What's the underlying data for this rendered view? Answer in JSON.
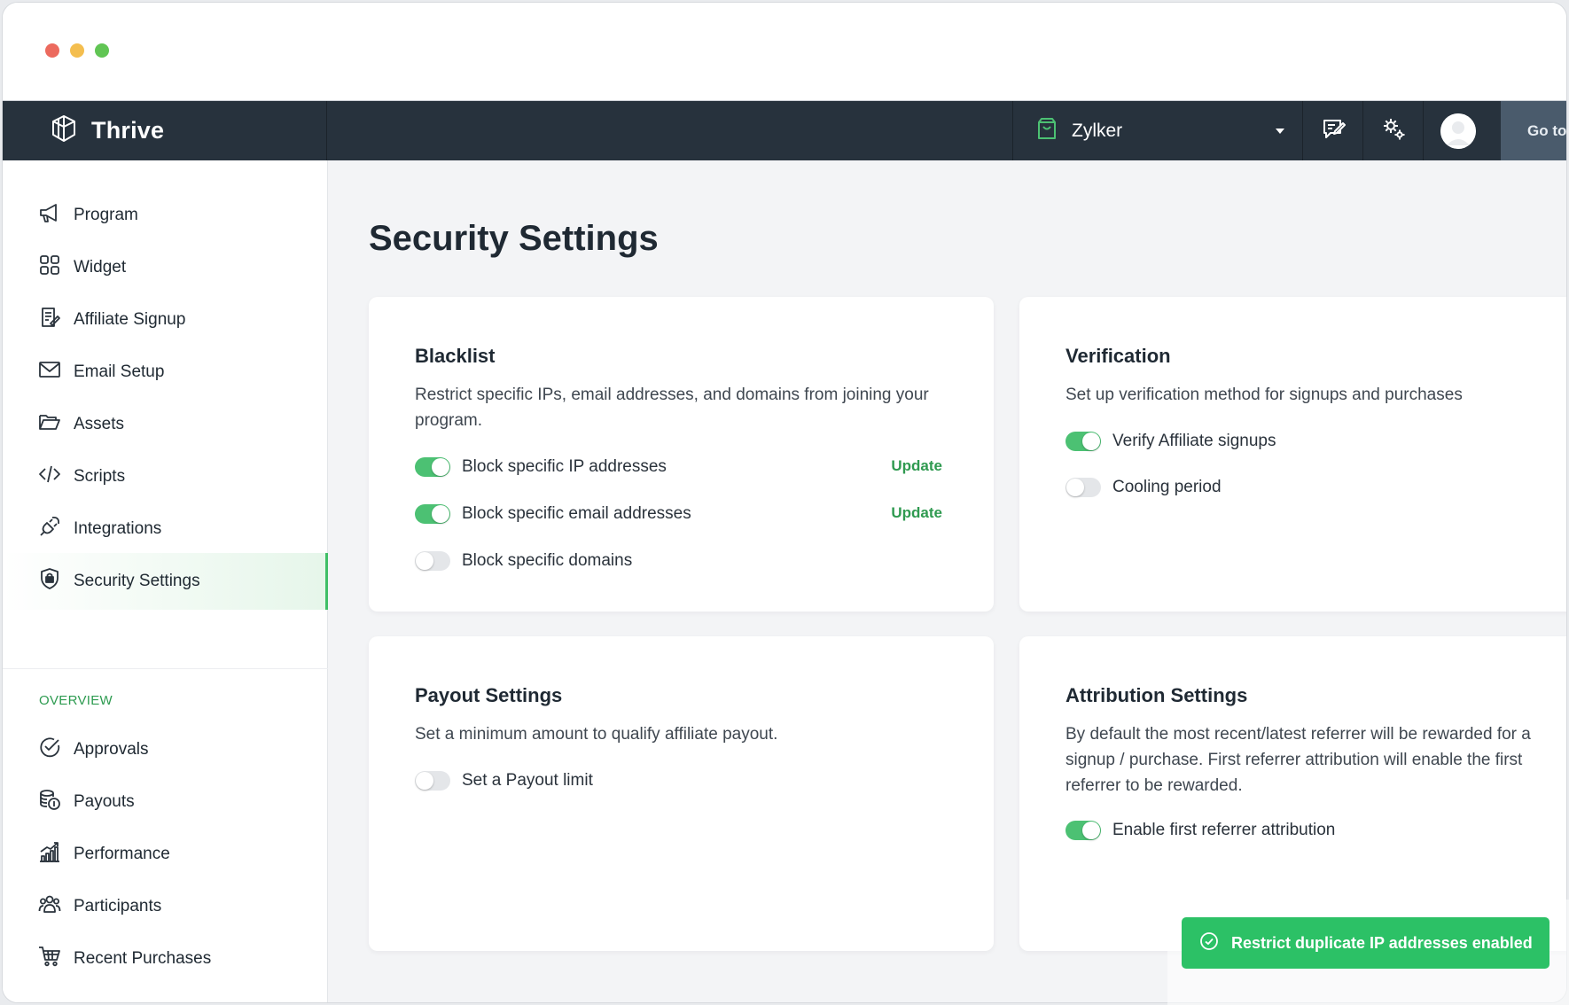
{
  "app": {
    "name": "Thrive",
    "org": "Zylker",
    "goto_label": "Go to"
  },
  "sidebar": {
    "items": [
      {
        "label": "Program",
        "icon": "megaphone-icon"
      },
      {
        "label": "Widget",
        "icon": "grid-icon"
      },
      {
        "label": "Affiliate Signup",
        "icon": "form-icon"
      },
      {
        "label": "Email Setup",
        "icon": "mail-icon"
      },
      {
        "label": "Assets",
        "icon": "folder-icon"
      },
      {
        "label": "Scripts",
        "icon": "code-icon"
      },
      {
        "label": "Integrations",
        "icon": "plug-icon"
      },
      {
        "label": "Security Settings",
        "icon": "shield-lock-icon",
        "active": true
      }
    ],
    "overview_heading": "OVERVIEW",
    "overview_items": [
      {
        "label": "Approvals",
        "icon": "check-circle-icon"
      },
      {
        "label": "Payouts",
        "icon": "coins-icon"
      },
      {
        "label": "Performance",
        "icon": "chart-icon"
      },
      {
        "label": "Participants",
        "icon": "people-icon"
      },
      {
        "label": "Recent Purchases",
        "icon": "cart-icon"
      }
    ]
  },
  "page": {
    "title": "Security Settings"
  },
  "blacklist": {
    "title": "Blacklist",
    "description": "Restrict specific IPs, email addresses, and domains from joining your program.",
    "options": [
      {
        "label": "Block specific IP addresses",
        "enabled": true,
        "action": "Update"
      },
      {
        "label": "Block specific email addresses",
        "enabled": true,
        "action": "Update"
      },
      {
        "label": "Block specific domains",
        "enabled": false
      }
    ]
  },
  "verification": {
    "title": "Verification",
    "description": "Set up verification method for signups and purchases",
    "options": [
      {
        "label": "Verify Affiliate signups",
        "enabled": true
      },
      {
        "label": "Cooling period",
        "enabled": false
      }
    ]
  },
  "payout": {
    "title": "Payout Settings",
    "description": "Set a minimum amount to qualify affiliate payout.",
    "options": [
      {
        "label": "Set a Payout limit",
        "enabled": false
      }
    ]
  },
  "attribution": {
    "title": "Attribution Settings",
    "description": "By default the most recent/latest referrer will be rewarded for a signup / purchase. First referrer attribution will enable the first referrer to be rewarded.",
    "options": [
      {
        "label": "Enable first referrer attribution",
        "enabled": true
      }
    ]
  },
  "toast": {
    "message": "Restrict duplicate IP addresses enabled"
  },
  "colors": {
    "nav_bg": "#27323d",
    "accent": "#4cc173",
    "toast_bg": "#2cc166",
    "link": "#2f9a50"
  }
}
